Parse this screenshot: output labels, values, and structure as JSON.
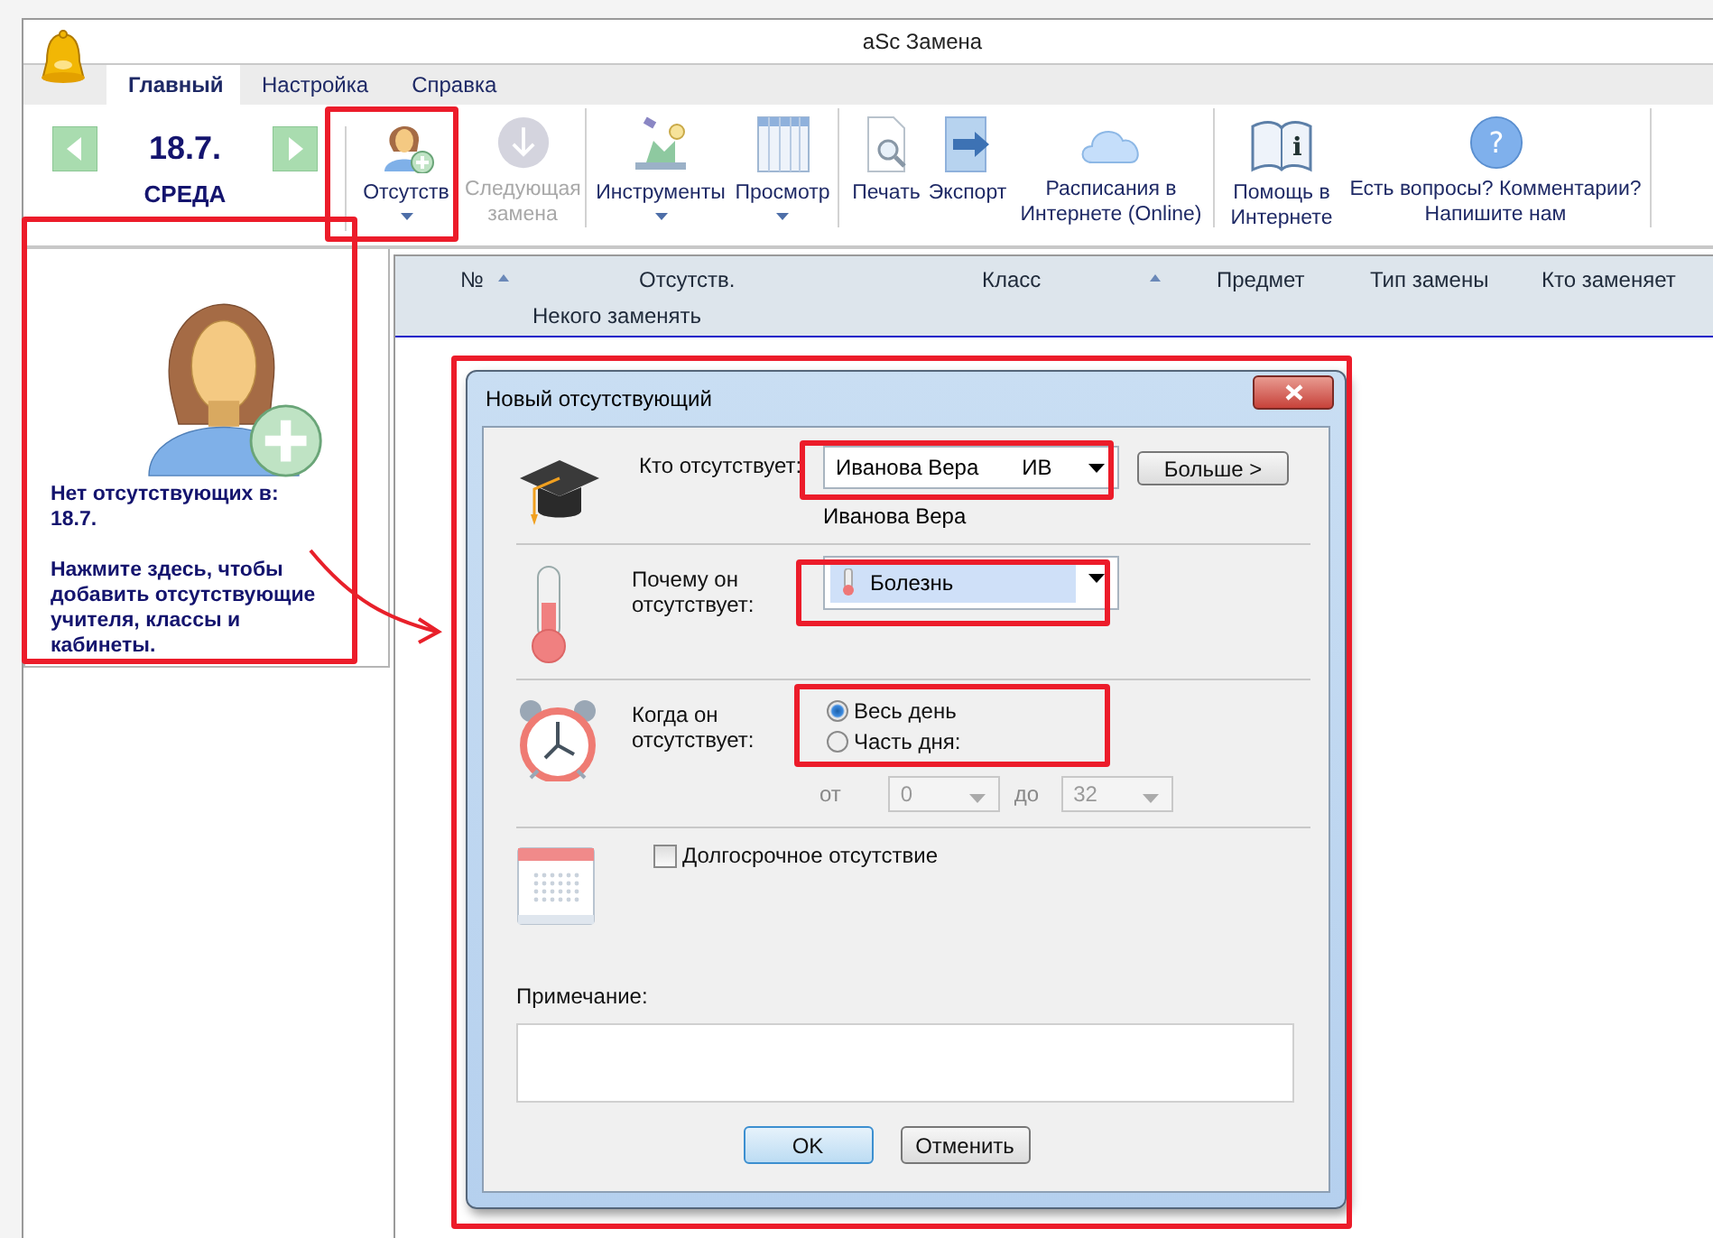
{
  "window": {
    "title": "aSc Замена"
  },
  "tabs": [
    {
      "label": "Главный",
      "selected": true
    },
    {
      "label": "Настройка",
      "selected": false
    },
    {
      "label": "Справка",
      "selected": false
    }
  ],
  "date_nav": {
    "date": "18.7.",
    "weekday": "СРЕДА"
  },
  "toolbar": [
    {
      "kind": "absent",
      "label": "Отсутств",
      "dropdown": true,
      "disabled": false,
      "group_end": false
    },
    {
      "kind": "next",
      "label": "Следующая замена",
      "dropdown": false,
      "disabled": true,
      "group_end": true
    },
    {
      "kind": "tools",
      "label": "Инструменты",
      "dropdown": true,
      "disabled": false,
      "group_end": false
    },
    {
      "kind": "view",
      "label": "Просмотр",
      "dropdown": true,
      "disabled": false,
      "group_end": true
    },
    {
      "kind": "print",
      "label": "Печать",
      "dropdown": false,
      "disabled": false,
      "group_end": false
    },
    {
      "kind": "export",
      "label": "Экспорт",
      "dropdown": false,
      "disabled": false,
      "group_end": false
    },
    {
      "kind": "cloud",
      "label": "Расписания в Интернете (Online)",
      "dropdown": false,
      "disabled": false,
      "group_end": true
    },
    {
      "kind": "book",
      "icon_text": "i",
      "label": "Помощь в Интернете",
      "dropdown": false,
      "disabled": false,
      "group_end": false
    },
    {
      "kind": "question",
      "icon_text": "?",
      "label": "Есть вопросы? Комментарии? Напишите нам",
      "dropdown": false,
      "disabled": false,
      "group_end": true
    }
  ],
  "side_panel": {
    "message": "Нет отсутствующих в:",
    "date": "18.7.",
    "hint": "Нажмите здесь, чтобы добавить отсутствующие учителя, классы и кабинеты."
  },
  "table": {
    "columns": [
      {
        "label": "№",
        "sorted": true
      },
      {
        "label": "Отсутств.",
        "sorted": false
      },
      {
        "label": "Класс",
        "sorted": true
      },
      {
        "label": "Предмет",
        "sorted": false
      },
      {
        "label": "Тип замены",
        "sorted": false
      },
      {
        "label": "Кто заменяет",
        "sorted": false
      }
    ],
    "empty_text": "Некого заменять"
  },
  "dialog": {
    "title": "Новый отсутствующий",
    "who": {
      "label": "Кто отсутствует:",
      "value": "Иванова Вера",
      "code": "ИВ",
      "name": "Иванова Вера"
    },
    "more_button": "Больше >",
    "reason": {
      "label": "Почему он отсутствует:",
      "value": "Болезнь"
    },
    "when": {
      "label": "Когда он отсутствует:",
      "options": [
        {
          "label": "Весь день",
          "selected": true
        },
        {
          "label": "Часть дня:",
          "selected": false
        }
      ],
      "from": {
        "label": "от",
        "value": "0",
        "disabled": true
      },
      "to": {
        "label": "до",
        "value": "32",
        "disabled": true
      }
    },
    "long_term": {
      "label": "Долгосрочное отсутствие",
      "checked": false
    },
    "note": {
      "label": "Примечание:"
    },
    "buttons": [
      {
        "label": "OK",
        "default": true
      },
      {
        "label": "Отменить",
        "default": false
      }
    ]
  }
}
